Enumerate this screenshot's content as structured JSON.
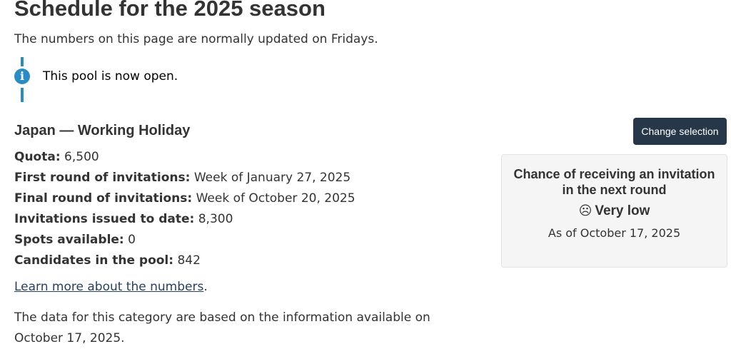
{
  "page": {
    "title": "Schedule for the 2025 season",
    "intro": "The numbers on this page are normally updated on Fridays."
  },
  "alert": {
    "icon": "info-icon",
    "text": "This pool is now open."
  },
  "category": {
    "heading": "Japan — Working Holiday",
    "change_button": "Change selection"
  },
  "stats": [
    {
      "label": "Quota:",
      "value": "6,500"
    },
    {
      "label": "First round of invitations:",
      "value": "Week of January 27, 2025"
    },
    {
      "label": "Final round of invitations:",
      "value": "Week of October 20, 2025"
    },
    {
      "label": "Invitations issued to date:",
      "value": "8,300"
    },
    {
      "label": "Spots available:",
      "value": "0"
    },
    {
      "label": "Candidates in the pool:",
      "value": "842"
    }
  ],
  "learn_more": {
    "link_text": "Learn more about the numbers",
    "suffix": "."
  },
  "footnote": "The data for this category are based on the information available on October 17, 2025.",
  "chance_panel": {
    "title": "Chance of receiving an invitation in the next round",
    "icon": "frown-icon",
    "value": "Very low",
    "as_of": "As of October 17, 2025"
  },
  "colors": {
    "accent": "#2b8cc4",
    "button_bg": "#26374a",
    "link": "#284162",
    "panel_bg": "#f5f5f5"
  }
}
